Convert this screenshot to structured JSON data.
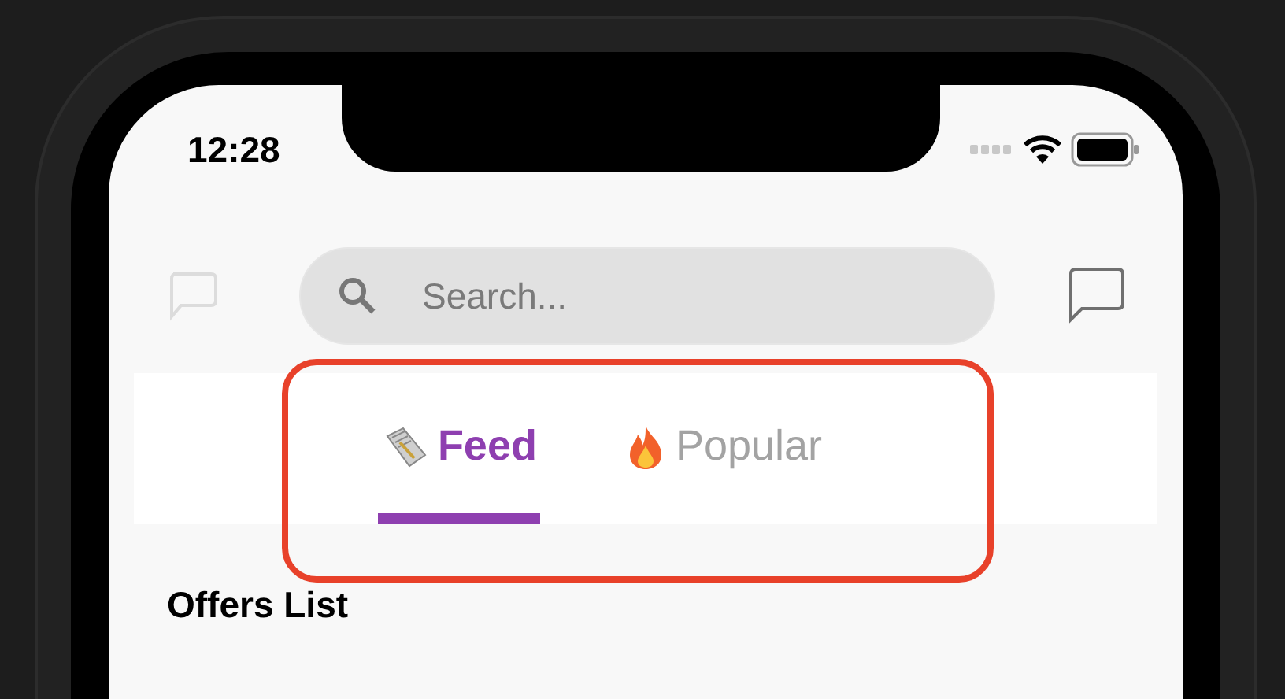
{
  "status_bar": {
    "time": "12:28"
  },
  "search": {
    "placeholder": "Search..."
  },
  "tabs": [
    {
      "label": "Feed",
      "kind": "feed",
      "selected": true
    },
    {
      "label": "Popular",
      "kind": "popular",
      "selected": false
    }
  ],
  "section": {
    "title": "Offers List"
  }
}
